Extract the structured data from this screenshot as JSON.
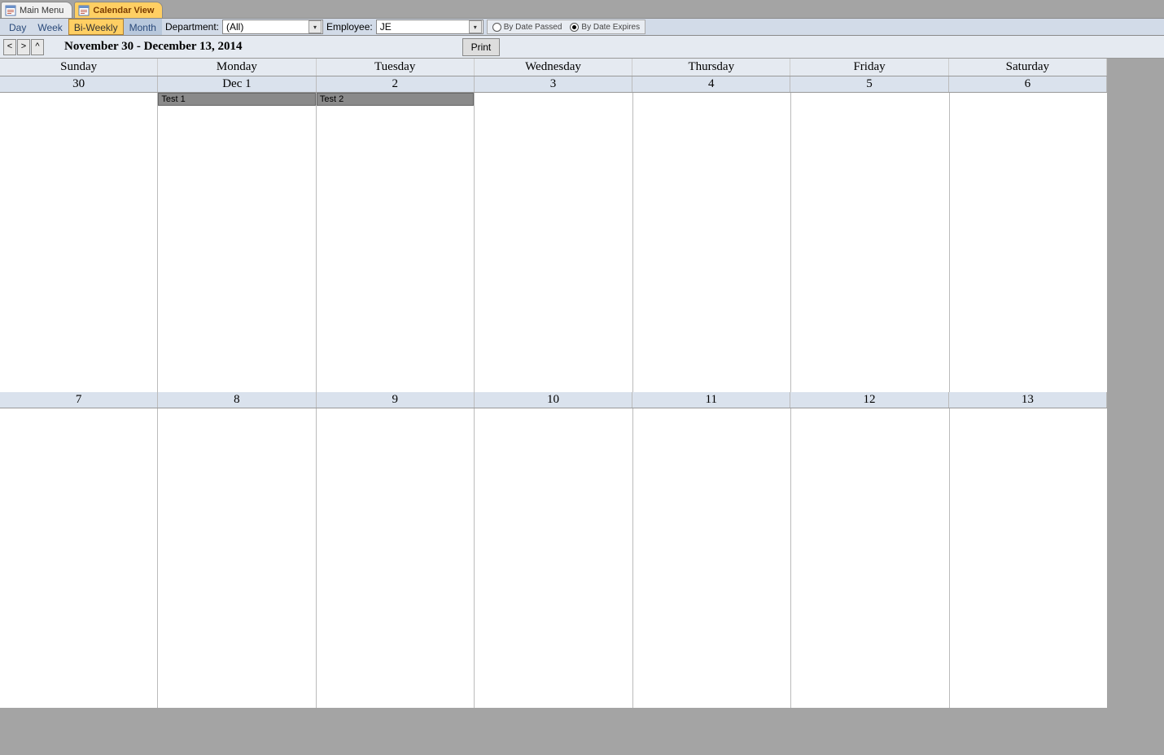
{
  "tabs": [
    {
      "label": "Main Menu",
      "active": false
    },
    {
      "label": "Calendar View",
      "active": true
    }
  ],
  "toolbar": {
    "views": {
      "day": "Day",
      "week": "Week",
      "biweekly": "Bi-Weekly",
      "month": "Month"
    },
    "department_label": "Department:",
    "department_value": "(All)",
    "employee_label": "Employee:",
    "employee_value": "JE",
    "radio_passed": "By Date Passed",
    "radio_expires": "By Date Expires"
  },
  "nav": {
    "prev": "<",
    "next": ">",
    "up": "^"
  },
  "date_range": "November 30 - December 13, 2014",
  "print_label": "Print",
  "day_headers": [
    "Sunday",
    "Monday",
    "Tuesday",
    "Wednesday",
    "Thursday",
    "Friday",
    "Saturday"
  ],
  "week1_dates": [
    "30",
    "Dec 1",
    "2",
    "3",
    "4",
    "5",
    "6"
  ],
  "week2_dates": [
    "7",
    "8",
    "9",
    "10",
    "11",
    "12",
    "13"
  ],
  "events": {
    "w1d1": "Test 1",
    "w1d2": "Test 2"
  }
}
